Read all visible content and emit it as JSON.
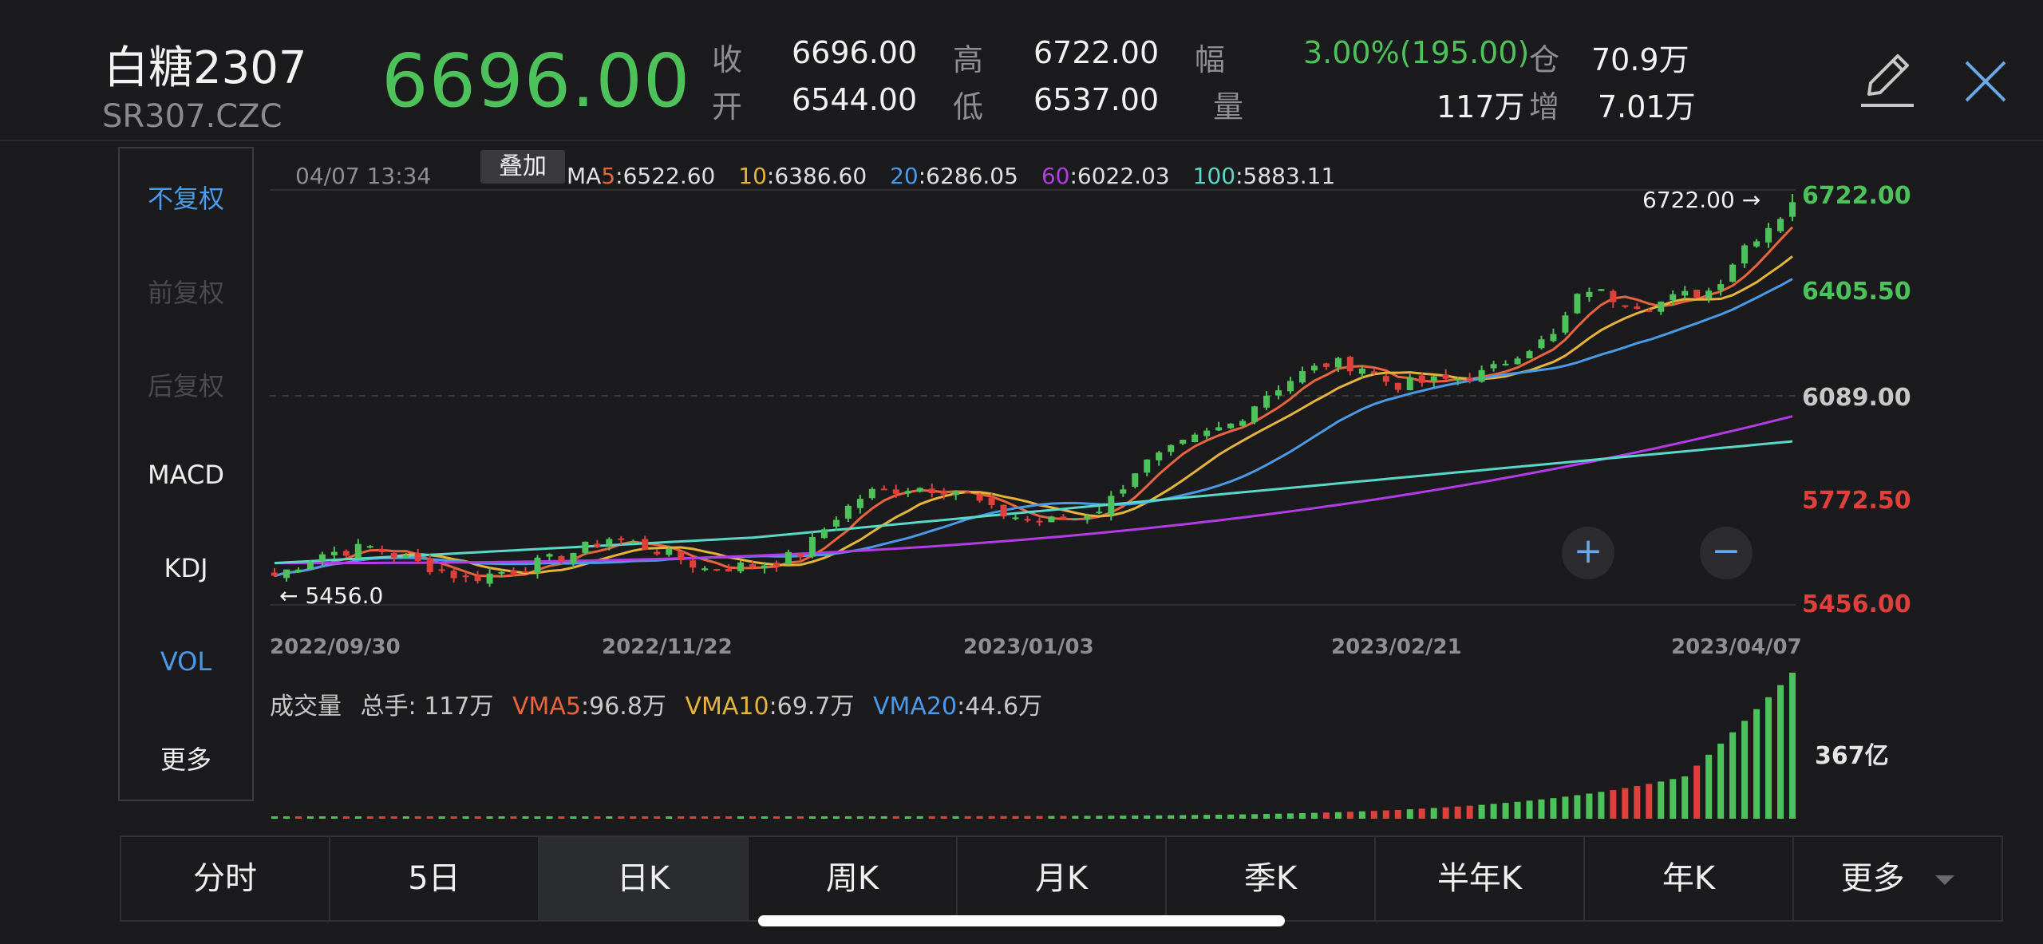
{
  "header": {
    "title": "白糖2307",
    "code": "SR307.CZC",
    "price": "6696.00",
    "stats": [
      {
        "label": "收",
        "value": "6696.00"
      },
      {
        "label": "高",
        "value": "6722.00"
      },
      {
        "label": "幅",
        "value": "3.00%(195.00)"
      },
      {
        "label": "仓",
        "value": "70.9万"
      },
      {
        "label": "开",
        "value": "6544.00"
      },
      {
        "label": "低",
        "value": "6537.00"
      },
      {
        "label": "量",
        "value": "117万"
      },
      {
        "label": "增",
        "value": "7.01万"
      }
    ],
    "edit_icon": "pencil-icon",
    "close_icon": "close-icon"
  },
  "sidebar": {
    "items": [
      {
        "label": "不复权",
        "state": "active"
      },
      {
        "label": "前复权",
        "state": "disabled"
      },
      {
        "label": "后复权",
        "state": "disabled"
      },
      {
        "label": "MACD",
        "state": "normal"
      },
      {
        "label": "KDJ",
        "state": "normal"
      },
      {
        "label": "VOL",
        "state": "active"
      },
      {
        "label": "更多",
        "state": "normal"
      }
    ]
  },
  "chart": {
    "timestamp": "04/07 13:34",
    "overlay_label": "叠加",
    "ma": [
      {
        "prefix": "MA",
        "period": "5",
        "value": ":6522.60",
        "color": "#e8643c"
      },
      {
        "prefix": "",
        "period": "10",
        "value": ":6386.60",
        "color": "#e6b43a"
      },
      {
        "prefix": "",
        "period": "20",
        "value": ":6286.05",
        "color": "#4a9ae8"
      },
      {
        "prefix": "",
        "period": "60",
        "value": ":6022.03",
        "color": "#b43ce6"
      },
      {
        "prefix": "",
        "period": "100",
        "value": ":5883.11",
        "color": "#5ad8c8"
      }
    ],
    "right_axis": [
      {
        "label": "6722.00",
        "color": "#4ec25a"
      },
      {
        "label": "6405.50",
        "color": "#4ec25a"
      },
      {
        "label": "6089.00",
        "color": "#c8c8c8"
      },
      {
        "label": "5772.50",
        "color": "#e0403c"
      },
      {
        "label": "5456.00",
        "color": "#e0403c"
      }
    ],
    "high_marker": "6722.00 →",
    "low_marker": "← 5456.0",
    "x_dates": [
      "2022/09/30",
      "2022/11/22",
      "2023/01/03",
      "2023/02/21",
      "2023/04/07"
    ],
    "zoom_in": "+",
    "zoom_out": "−"
  },
  "volume": {
    "title": "成交量",
    "total": "总手: 117万",
    "vma": [
      {
        "name": "VMA5",
        "value": ":96.8万",
        "color": "#e8643c"
      },
      {
        "name": "VMA10",
        "value": ":69.7万",
        "color": "#e6b43a"
      },
      {
        "name": "VMA20",
        "value": ":44.6万",
        "color": "#4a9ae8"
      }
    ],
    "axis_label": "367亿"
  },
  "tabs": [
    {
      "label": "分时"
    },
    {
      "label": "5日"
    },
    {
      "label": "日K",
      "active": true
    },
    {
      "label": "周K"
    },
    {
      "label": "月K"
    },
    {
      "label": "季K"
    },
    {
      "label": "半年K"
    },
    {
      "label": "年K"
    },
    {
      "label": "更多"
    }
  ],
  "colors": {
    "up": "#4ec25a",
    "down": "#e0403c",
    "accent": "#4a9ae8",
    "background": "#1b1b1e"
  }
}
